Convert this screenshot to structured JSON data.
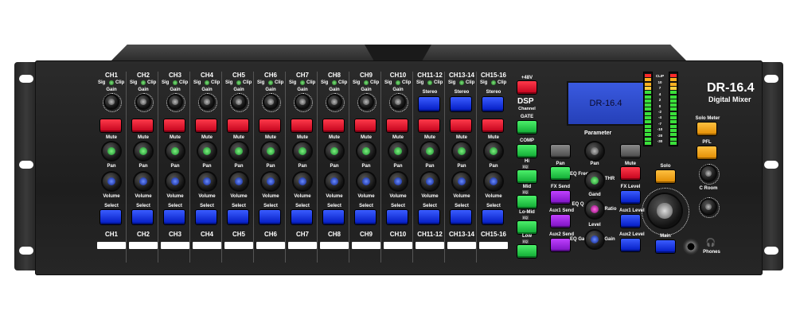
{
  "device": {
    "model": "DR-16.4",
    "subtitle": "Digital Mixer",
    "lcd_text": "DR-16.4",
    "dsp_label": "DSP",
    "dsp_sub": "Channel",
    "parameter_label": "Parameter"
  },
  "strip_labels": {
    "sig": "Sig",
    "clip": "Clip",
    "gain": "Gain",
    "stereo": "Stereo",
    "mute": "Mute",
    "pan": "Pan",
    "volume": "Volume",
    "select": "Select"
  },
  "channels": [
    {
      "name": "CH1",
      "footer": "CH1",
      "stereo": false
    },
    {
      "name": "CH2",
      "footer": "CH2",
      "stereo": false
    },
    {
      "name": "CH3",
      "footer": "CH3",
      "stereo": false
    },
    {
      "name": "CH4",
      "footer": "CH4",
      "stereo": false
    },
    {
      "name": "CH5",
      "footer": "CH5",
      "stereo": false
    },
    {
      "name": "CH6",
      "footer": "CH6",
      "stereo": false
    },
    {
      "name": "CH7",
      "footer": "CH7",
      "stereo": false
    },
    {
      "name": "CH8",
      "footer": "CH8",
      "stereo": false
    },
    {
      "name": "CH9",
      "footer": "CH9",
      "stereo": false
    },
    {
      "name": "CH10",
      "footer": "CH10",
      "stereo": false
    },
    {
      "name": "CH11-12",
      "footer": "CH11-12",
      "stereo": true
    },
    {
      "name": "CH13-14",
      "footer": "CH13-14",
      "stereo": true
    },
    {
      "name": "CH15-16",
      "footer": "CH15-16",
      "stereo": true
    }
  ],
  "dsp_buttons": {
    "phantom": "+48V",
    "gate": "GATE",
    "comp": "COMP",
    "hi": "Hi",
    "mid": "Mid",
    "lomid": "Lo-Mid",
    "low": "Low",
    "eq_tag": "EQ"
  },
  "param_controls": {
    "pan": "Pan",
    "fx_send": "FX Send",
    "aux1_send": "Aux1 Send",
    "aux2_send": "Aux2 Send",
    "eq_freq": "EQ Freq",
    "thr": "THR",
    "eq_q": "EQ Q",
    "gand": "Gand",
    "ratio": "Ratio",
    "level": "Level",
    "eq_gain": "EQ Gain",
    "gain": "Gain",
    "mute": "Mute",
    "fx_level": "FX Level",
    "aux1_level": "Aux1 Level",
    "aux2_level": "Aux2 Level"
  },
  "meter": {
    "clip_label": "CLIP",
    "scale": [
      "10",
      "7",
      "4",
      "2",
      "0",
      "-2",
      "-4",
      "-7",
      "-10",
      "-20",
      "-30"
    ]
  },
  "master": {
    "solo_meter": "Solo Meter",
    "pfl": "PFL",
    "solo": "Solo",
    "croom": "C Room",
    "main": "Main",
    "phones": "Phones"
  },
  "colors": {
    "red": "#e0102a",
    "blue": "#1a36e8",
    "green": "#22cc44",
    "purple": "#a020f0",
    "orange": "#f8a820",
    "panel": "#262626"
  }
}
